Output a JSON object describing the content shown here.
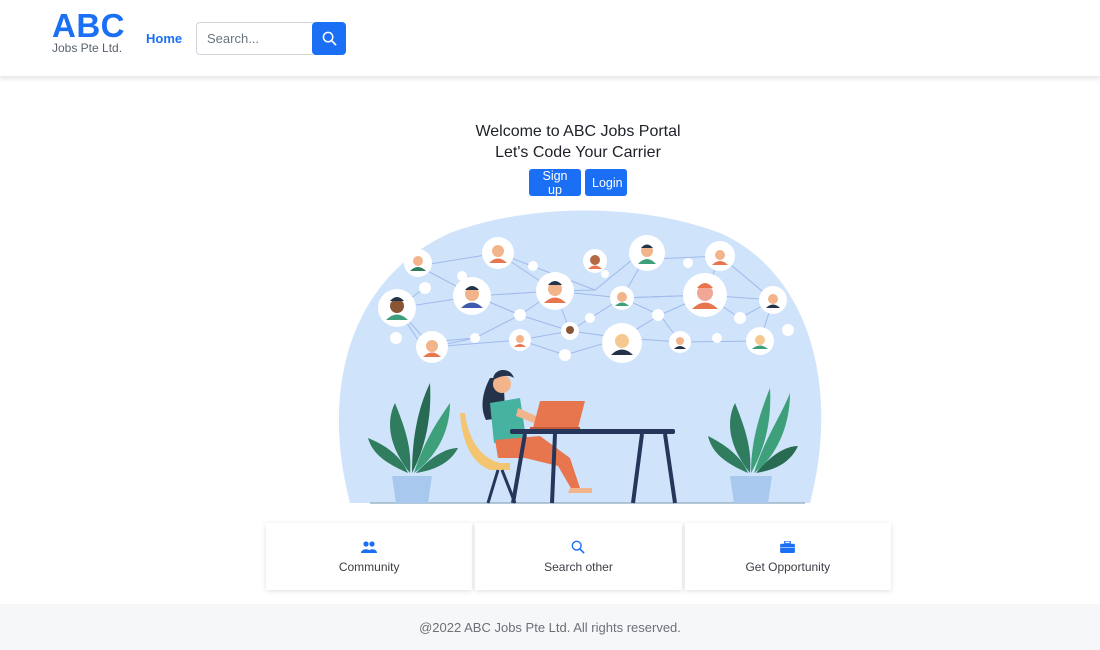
{
  "header": {
    "brand_title": "ABC",
    "brand_subtitle": "Jobs Pte Ltd.",
    "nav_home": "Home",
    "search_placeholder": "Search..."
  },
  "hero": {
    "line1": "Welcome to ABC Jobs Portal",
    "line2": "Let's Code Your Carrier",
    "signup_label": "Sign up",
    "login_label": "Login"
  },
  "features": [
    {
      "label": "Community",
      "icon": "people-icon"
    },
    {
      "label": "Search other",
      "icon": "search-icon"
    },
    {
      "label": "Get Opportunity",
      "icon": "briefcase-icon"
    }
  ],
  "footer": {
    "text": "@2022 ABC Jobs Pte Ltd. All rights reserved."
  },
  "colors": {
    "primary": "#1a6ff5",
    "footer_bg": "#f6f7f8",
    "illustration_bg": "#cfe3fb"
  }
}
